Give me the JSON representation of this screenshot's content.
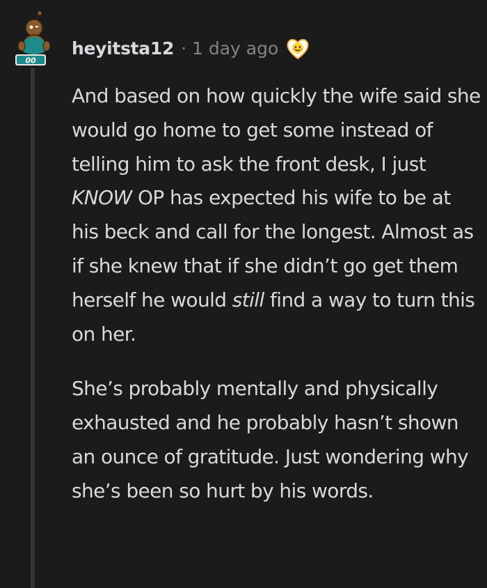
{
  "comment": {
    "username": "heyitsta12",
    "separator": "·",
    "timestamp": "1 day ago",
    "avatar_icon": "snoo-avatar-icon",
    "award_icon": "wholesome-award-icon",
    "paragraphs": [
      {
        "segments": [
          {
            "text": "And based on how quickly the wife said she would go home to get some instead of telling him to ask the front desk, I just ",
            "italic": false
          },
          {
            "text": "KNOW",
            "italic": true
          },
          {
            "text": " OP has expected his wife to be at his beck and call for the longest. Almost as if she knew that if she didn’t go get them herself he would ",
            "italic": false
          },
          {
            "text": "still",
            "italic": true
          },
          {
            "text": " find a way to turn this on her.",
            "italic": false
          }
        ]
      },
      {
        "segments": [
          {
            "text": "She’s probably mentally and physically exhausted and he probably hasn’t shown an ounce of gratitude. Just wondering why she’s been so hurt by his words.",
            "italic": false
          }
        ]
      }
    ]
  },
  "colors": {
    "background": "#1b1b1c",
    "text": "#d7dadc",
    "meta": "#818384",
    "thread_line": "#343536"
  }
}
